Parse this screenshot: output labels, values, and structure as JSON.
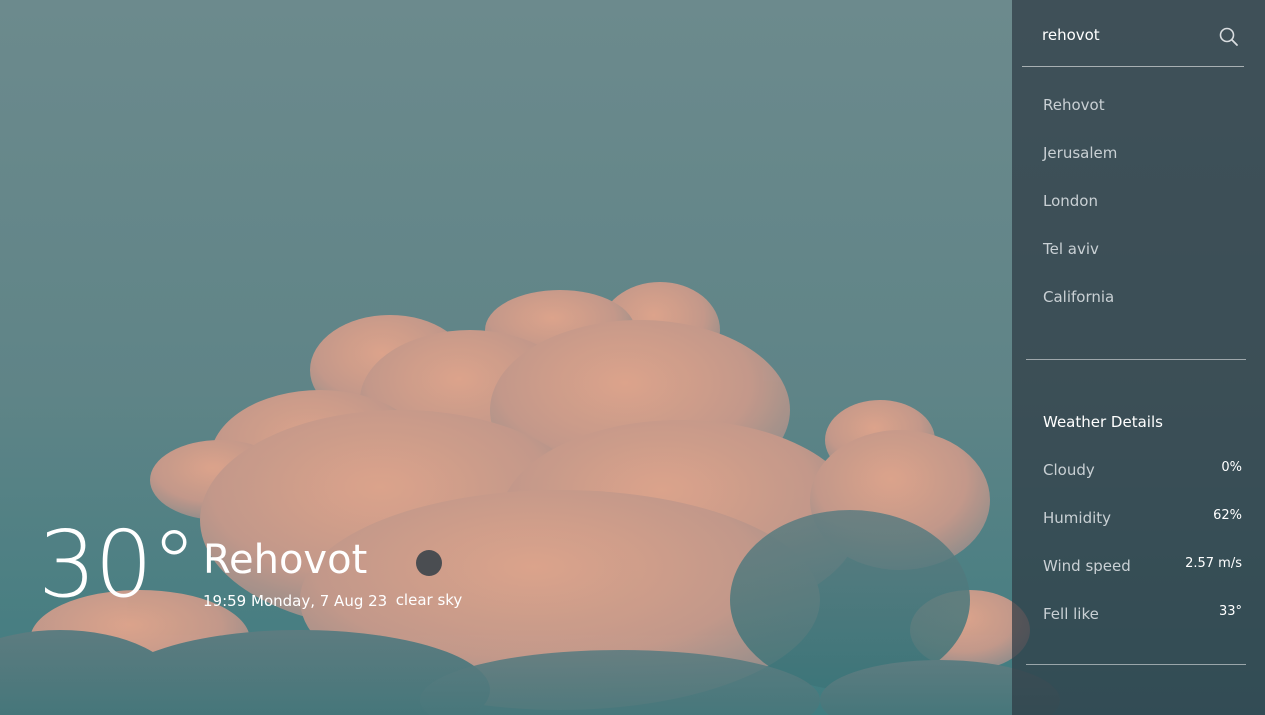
{
  "search": {
    "value": "rehovot",
    "icon": "search-icon"
  },
  "cities": [
    "Rehovot",
    "Jerusalem",
    "London",
    "Tel aviv",
    "California"
  ],
  "weather": {
    "temperature": "30°",
    "city": "Rehovot",
    "datetime": "19:59 Monday, 7 Aug 23",
    "condition": "clear sky",
    "condition_icon": "weather-condition-icon"
  },
  "details": {
    "title": "Weather Details",
    "rows": [
      {
        "label": "Cloudy",
        "value": "0%"
      },
      {
        "label": "Humidity",
        "value": "62%"
      },
      {
        "label": "Wind speed",
        "value": "2.57 m/s"
      },
      {
        "label": "Fell like",
        "value": "33°"
      }
    ]
  },
  "colors": {
    "sky": "#6a878a",
    "panel": "#2e3a44",
    "text": "#ffffff",
    "muted_text": "#c9d0d4"
  }
}
